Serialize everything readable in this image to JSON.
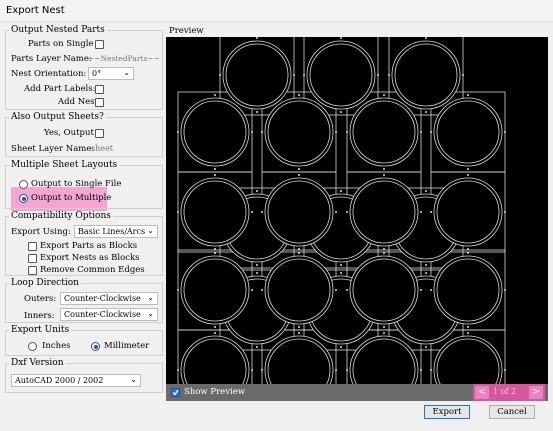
{
  "window": {
    "title": "Export Nest"
  },
  "nested_parts": {
    "title": "Output Nested Parts",
    "parts_on_single_label": "Parts on Single",
    "parts_layer_label": "Parts Layer Name:",
    "parts_layer_value": "~~NestedParts~~",
    "nest_orientation_label": "Nest Orientation:",
    "nest_orientation_value": "0°",
    "add_part_labels_label": "Add Part Labels:",
    "add_nest_label": "Add Nest"
  },
  "sheets": {
    "title": "Also Output Sheets?",
    "yes_output_label": "Yes, Output",
    "sheet_layer_label": "Sheet Layer Name:",
    "sheet_layer_value": "sheet"
  },
  "multiple": {
    "title": "Multiple Sheet Layouts",
    "single_label": "Output to Single File",
    "multiple_label": "Output to Multiple",
    "selected": "multiple"
  },
  "compat": {
    "title": "Compatibility Options",
    "export_using_label": "Export Using:",
    "export_using_value": "Basic Lines/Arcs",
    "export_parts_blocks": "Export Parts as Blocks",
    "export_nests_blocks": "Export Nests as Blocks",
    "remove_common_edges": "Remove Common Edges"
  },
  "loop": {
    "title": "Loop Direction",
    "outers_label": "Outers:",
    "outers_value": "Counter-Clockwise",
    "inners_label": "Inners:",
    "inners_value": "Counter-Clockwise"
  },
  "units": {
    "title": "Export Units",
    "inches_label": "Inches",
    "mm_label": "Millimeter",
    "selected": "Millimeter"
  },
  "dxf": {
    "title": "Dxf Version",
    "value": "AutoCAD 2000 / 2002"
  },
  "preview": {
    "title": "Preview",
    "show_preview_label": "Show Preview",
    "show_preview_checked": true,
    "page_indicator": "1 of 2"
  },
  "buttons": {
    "export": "Export",
    "cancel": "Cancel"
  },
  "colors": {
    "canvas_bg": "#000000",
    "part_stroke": "#d8d8d8",
    "highlight": "#f3a6cf",
    "nav_bg": "#d7579f"
  }
}
